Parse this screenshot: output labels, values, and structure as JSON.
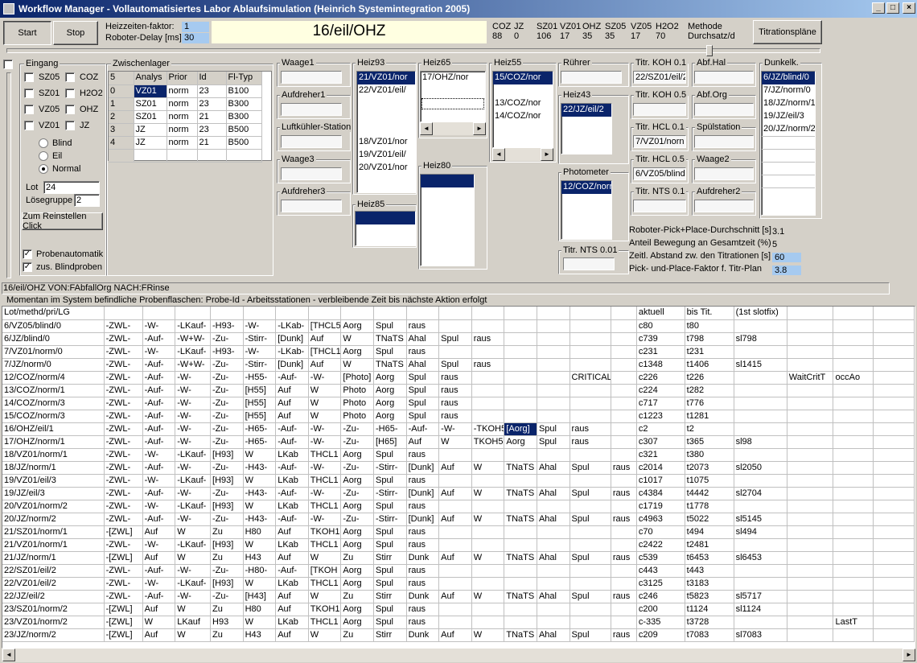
{
  "window": {
    "title": "Workflow Manager - Vollautomatisiertes Labor Ablaufsimulation (Heinrich Systemintegration 2005)",
    "min": "_",
    "max": "□",
    "close": "×"
  },
  "toolbar": {
    "start": "Start",
    "stop": "Stop",
    "heiz_label": "Heizzeiten-faktor:",
    "heiz_value": "1",
    "delay_label": "Roboter-Delay [ms]",
    "delay_value": "30",
    "current": "16/eil/OHZ",
    "titration": "Titrationspläne"
  },
  "counters": [
    {
      "name": "COZ",
      "value": "88"
    },
    {
      "name": "JZ",
      "value": "0"
    },
    {
      "name": "SZ01",
      "value": "106"
    },
    {
      "name": "VZ01",
      "value": "17"
    },
    {
      "name": "OHZ",
      "value": "35"
    },
    {
      "name": "SZ05",
      "value": "35"
    },
    {
      "name": "VZ05",
      "value": "17"
    },
    {
      "name": "H2O2",
      "value": "70"
    }
  ],
  "methode": {
    "label": "Methode",
    "value": "Durchsatz/d"
  },
  "eingang": {
    "title": "Eingang",
    "checks": [
      {
        "label": "SZ05",
        "checked": false
      },
      {
        "label": "COZ",
        "checked": false
      },
      {
        "label": "SZ01",
        "checked": false
      },
      {
        "label": "H2O2",
        "checked": false
      },
      {
        "label": "VZ05",
        "checked": false
      },
      {
        "label": "OHZ",
        "checked": false
      },
      {
        "label": "VZ01",
        "checked": false
      },
      {
        "label": "JZ",
        "checked": false
      }
    ],
    "radios": [
      {
        "label": "Blind",
        "on": false
      },
      {
        "label": "Eil",
        "on": false
      },
      {
        "label": "Normal",
        "on": true
      }
    ],
    "lot_label": "Lot",
    "lot_value": "24",
    "group_label": "Lösegruppe",
    "group_value": "2",
    "reinstellen": "Zum Reinstellen Click",
    "probenautomatik": "Probenautomatik",
    "blindproben": "zus. Blindproben"
  },
  "zwischenlager": {
    "title": "Zwischenlager",
    "headers": [
      "5",
      "Analys",
      "Prior",
      "Id",
      "Fl-Typ"
    ],
    "rows": [
      [
        "0",
        "VZ01",
        "norm",
        "23",
        "B100"
      ],
      [
        "1",
        "SZ01",
        "norm",
        "23",
        "B300"
      ],
      [
        "2",
        "SZ01",
        "norm",
        "21",
        "B300"
      ],
      [
        "3",
        "JZ",
        "norm",
        "23",
        "B500"
      ],
      [
        "4",
        "JZ",
        "norm",
        "21",
        "B500"
      ],
      [
        "",
        "",
        "",
        "",
        ""
      ]
    ]
  },
  "stations": {
    "waage1": "Waage1",
    "aufdreher1": "Aufdreher1",
    "luftkuehler": "Luftkühler-Station",
    "waage3": "Waage3",
    "aufdreher3": "Aufdreher3",
    "heiz93": {
      "title": "Heiz93",
      "items": [
        "21/VZ01/nor",
        "22/VZ01/eil/",
        "",
        "",
        "",
        "18/VZ01/nor",
        "19/VZ01/eil/",
        "20/VZ01/nor"
      ]
    },
    "heiz85": "Heiz85",
    "heiz65": {
      "title": "Heiz65",
      "items": [
        "17/OHZ/nor",
        "",
        ""
      ]
    },
    "heiz80": "Heiz80",
    "heiz55": {
      "title": "Heiz55",
      "items": [
        "15/COZ/nor",
        "",
        "13/COZ/nor",
        "14/COZ/nor"
      ]
    },
    "ruehrer": "Rührer",
    "heiz43": {
      "title": "Heiz43",
      "items": [
        "22/JZ/eil/2"
      ]
    },
    "photometer": {
      "title": "Photometer",
      "items": [
        "12/COZ/norn"
      ]
    },
    "titrnts001": "Titr. NTS 0.01",
    "titrkoh01": {
      "title": "Titr. KOH 0.1",
      "value": "22/SZ01/eil/2"
    },
    "titrkoh05": "Titr. KOH 0.5",
    "titrhcl01": {
      "title": "Titr. HCL 0.1",
      "value": "7/VZ01/norn"
    },
    "titrhcl05": {
      "title": "Titr. HCL 0.5",
      "value": "6/VZ05/blind"
    },
    "titrnts01": "Titr. NTS 0.1",
    "abfhal": "Abf.Hal",
    "abforg": "Abf.Org",
    "spuel": "Spülstation",
    "waage2": "Waage2",
    "aufdreher2": "Aufdreher2",
    "dunkel": {
      "title": "Dunkelk.",
      "items": [
        "6/JZ/blind/0",
        "7/JZ/norm/0",
        "18/JZ/norm/1",
        "19/JZ/eil/3",
        "20/JZ/norm/2"
      ]
    }
  },
  "stats": [
    {
      "label": "Roboter-Pick+Place-Durchschnitt [s]",
      "value": "3.1",
      "boxed": false
    },
    {
      "label": "Anteil Bewegung an Gesamtzeit (%)",
      "value": "5",
      "boxed": false
    },
    {
      "label": "Zeitl. Abstand zw. den Titrationen [s]",
      "value": "60",
      "boxed": true
    },
    {
      "label": "Pick- und-Place-Faktor f. Titr-Plan",
      "value": "3.8",
      "boxed": true
    }
  ],
  "status": "16/eil/OHZ VON:FAbfallOrg NACH:FRinse",
  "legend": "Momentan im System befindliche Probenflaschen:  Probe-Id    -     Arbeitsstationen        -          verbleibende Zeit bis nächste Aktion erfolgt",
  "grid": {
    "headers": [
      "Lot/methd/pri/LG",
      "",
      "",
      "",
      "",
      "",
      "",
      "",
      "",
      "",
      "",
      "",
      "",
      "",
      "",
      "",
      "",
      "aktuell",
      "bis Tit.",
      "(1st slotfix)",
      "",
      "",
      ""
    ],
    "rows": [
      [
        "6/VZ05/blind/0",
        "-ZWL-",
        "-W-",
        "-LKauf-",
        "-H93-",
        "-W-",
        "-LKab-",
        "[THCL5",
        "Aorg",
        "Spul",
        "raus",
        "",
        "",
        "",
        "",
        "",
        "",
        "c80",
        "t80",
        "",
        "",
        "",
        ""
      ],
      [
        "6/JZ/blind/0",
        "-ZWL-",
        "-Auf-",
        "-W+W-",
        "-Zu-",
        "-Stirr-",
        "[Dunk]",
        "Auf",
        "W",
        "TNaTS",
        "Ahal",
        "Spul",
        "raus",
        "",
        "",
        "",
        "",
        "c739",
        "t798",
        "sl798",
        "",
        "",
        ""
      ],
      [
        "7/VZ01/norm/0",
        "-ZWL-",
        "-W-",
        "-LKauf-",
        "-H93-",
        "-W-",
        "-LKab-",
        "[THCL1",
        "Aorg",
        "Spul",
        "raus",
        "",
        "",
        "",
        "",
        "",
        "",
        "c231",
        "t231",
        "",
        "",
        "",
        ""
      ],
      [
        "7/JZ/norm/0",
        "-ZWL-",
        "-Auf-",
        "-W+W-",
        "-Zu-",
        "-Stirr-",
        "[Dunk]",
        "Auf",
        "W",
        "TNaTS",
        "Ahal",
        "Spul",
        "raus",
        "",
        "",
        "",
        "",
        "c1348",
        "t1406",
        "sl1415",
        "",
        "",
        ""
      ],
      [
        "12/COZ/norm/4",
        "-ZWL-",
        "-Auf-",
        "-W-",
        "-Zu-",
        "-H55-",
        "-Auf-",
        "-W-",
        "[Photo]",
        "Aorg",
        "Spul",
        "raus",
        "",
        "",
        "",
        "CRITICAL",
        "",
        "c226",
        "t226",
        "",
        "WaitCritT",
        "occAo",
        ""
      ],
      [
        "13/COZ/norm/1",
        "-ZWL-",
        "-Auf-",
        "-W-",
        "-Zu-",
        "[H55]",
        "Auf",
        "W",
        "Photo",
        "Aorg",
        "Spul",
        "raus",
        "",
        "",
        "",
        "",
        "",
        "c224",
        "t282",
        "",
        "",
        "",
        ""
      ],
      [
        "14/COZ/norm/3",
        "-ZWL-",
        "-Auf-",
        "-W-",
        "-Zu-",
        "[H55]",
        "Auf",
        "W",
        "Photo",
        "Aorg",
        "Spul",
        "raus",
        "",
        "",
        "",
        "",
        "",
        "c717",
        "t776",
        "",
        "",
        "",
        ""
      ],
      [
        "15/COZ/norm/3",
        "-ZWL-",
        "-Auf-",
        "-W-",
        "-Zu-",
        "[H55]",
        "Auf",
        "W",
        "Photo",
        "Aorg",
        "Spul",
        "raus",
        "",
        "",
        "",
        "",
        "",
        "c1223",
        "t1281",
        "",
        "",
        "",
        ""
      ],
      [
        "16/OHZ/eil/1",
        "-ZWL-",
        "-Auf-",
        "-W-",
        "-Zu-",
        "-H65-",
        "-Auf-",
        "-W-",
        "-Zu-",
        "-H65-",
        "-Auf-",
        "-W-",
        "-TKOH5",
        "[Aorg]",
        "Spul",
        "raus",
        "",
        "c2",
        "t2",
        "",
        "",
        "",
        ""
      ],
      [
        "17/OHZ/norm/1",
        "-ZWL-",
        "-Auf-",
        "-W-",
        "-Zu-",
        "-H65-",
        "-Auf-",
        "-W-",
        "-Zu-",
        "[H65]",
        "Auf",
        "W",
        "TKOH5",
        "Aorg",
        "Spul",
        "raus",
        "",
        "c307",
        "t365",
        "sl98",
        "",
        "",
        ""
      ],
      [
        "18/VZ01/norm/1",
        "-ZWL-",
        "-W-",
        "-LKauf-",
        "[H93]",
        "W",
        "LKab",
        "THCL1",
        "Aorg",
        "Spul",
        "raus",
        "",
        "",
        "",
        "",
        "",
        "",
        "c321",
        "t380",
        "",
        "",
        "",
        ""
      ],
      [
        "18/JZ/norm/1",
        "-ZWL-",
        "-Auf-",
        "-W-",
        "-Zu-",
        "-H43-",
        "-Auf-",
        "-W-",
        "-Zu-",
        "-Stirr-",
        "[Dunk]",
        "Auf",
        "W",
        "TNaTS",
        "Ahal",
        "Spul",
        "raus",
        "c2014",
        "t2073",
        "sl2050",
        "",
        "",
        ""
      ],
      [
        "19/VZ01/eil/3",
        "-ZWL-",
        "-W-",
        "-LKauf-",
        "[H93]",
        "W",
        "LKab",
        "THCL1",
        "Aorg",
        "Spul",
        "raus",
        "",
        "",
        "",
        "",
        "",
        "",
        "c1017",
        "t1075",
        "",
        "",
        "",
        ""
      ],
      [
        "19/JZ/eil/3",
        "-ZWL-",
        "-Auf-",
        "-W-",
        "-Zu-",
        "-H43-",
        "-Auf-",
        "-W-",
        "-Zu-",
        "-Stirr-",
        "[Dunk]",
        "Auf",
        "W",
        "TNaTS",
        "Ahal",
        "Spul",
        "raus",
        "c4384",
        "t4442",
        "sl2704",
        "",
        "",
        ""
      ],
      [
        "20/VZ01/norm/2",
        "-ZWL-",
        "-W-",
        "-LKauf-",
        "[H93]",
        "W",
        "LKab",
        "THCL1",
        "Aorg",
        "Spul",
        "raus",
        "",
        "",
        "",
        "",
        "",
        "",
        "c1719",
        "t1778",
        "",
        "",
        "",
        ""
      ],
      [
        "20/JZ/norm/2",
        "-ZWL-",
        "-Auf-",
        "-W-",
        "-Zu-",
        "-H43-",
        "-Auf-",
        "-W-",
        "-Zu-",
        "-Stirr-",
        "[Dunk]",
        "Auf",
        "W",
        "TNaTS",
        "Ahal",
        "Spul",
        "raus",
        "c4963",
        "t5022",
        "sl5145",
        "",
        "",
        ""
      ],
      [
        "21/SZ01/norm/1",
        "-[ZWL]",
        "Auf",
        "W",
        "Zu",
        "H80",
        "Auf",
        "TKOH1",
        "Aorg",
        "Spul",
        "raus",
        "",
        "",
        "",
        "",
        "",
        "",
        "c70",
        "t494",
        "sl494",
        "",
        "",
        ""
      ],
      [
        "21/VZ01/norm/1",
        "-ZWL-",
        "-W-",
        "-LKauf-",
        "[H93]",
        "W",
        "LKab",
        "THCL1",
        "Aorg",
        "Spul",
        "raus",
        "",
        "",
        "",
        "",
        "",
        "",
        "c2422",
        "t2481",
        "",
        "",
        "",
        ""
      ],
      [
        "21/JZ/norm/1",
        "-[ZWL]",
        "Auf",
        "W",
        "Zu",
        "H43",
        "Auf",
        "W",
        "Zu",
        "Stirr",
        "Dunk",
        "Auf",
        "W",
        "TNaTS",
        "Ahal",
        "Spul",
        "raus",
        "c539",
        "t6453",
        "sl6453",
        "",
        "",
        ""
      ],
      [
        "22/SZ01/eil/2",
        "-ZWL-",
        "-Auf-",
        "-W-",
        "-Zu-",
        "-H80-",
        "-Auf-",
        "[TKOH",
        "Aorg",
        "Spul",
        "raus",
        "",
        "",
        "",
        "",
        "",
        "",
        "c443",
        "t443",
        "",
        "",
        "",
        ""
      ],
      [
        "22/VZ01/eil/2",
        "-ZWL-",
        "-W-",
        "-LKauf-",
        "[H93]",
        "W",
        "LKab",
        "THCL1",
        "Aorg",
        "Spul",
        "raus",
        "",
        "",
        "",
        "",
        "",
        "",
        "c3125",
        "t3183",
        "",
        "",
        "",
        ""
      ],
      [
        "22/JZ/eil/2",
        "-ZWL-",
        "-Auf-",
        "-W-",
        "-Zu-",
        "[H43]",
        "Auf",
        "W",
        "Zu",
        "Stirr",
        "Dunk",
        "Auf",
        "W",
        "TNaTS",
        "Ahal",
        "Spul",
        "raus",
        "c246",
        "t5823",
        "sl5717",
        "",
        "",
        ""
      ],
      [
        "23/SZ01/norm/2",
        "-[ZWL]",
        "Auf",
        "W",
        "Zu",
        "H80",
        "Auf",
        "TKOH1",
        "Aorg",
        "Spul",
        "raus",
        "",
        "",
        "",
        "",
        "",
        "",
        "c200",
        "t1124",
        "sl1124",
        "",
        "",
        ""
      ],
      [
        "23/VZ01/norm/2",
        "-[ZWL]",
        "W",
        "LKauf",
        "H93",
        "W",
        "LKab",
        "THCL1",
        "Aorg",
        "Spul",
        "raus",
        "",
        "",
        "",
        "",
        "",
        "",
        "c-335",
        "t3728",
        "",
        "",
        "LastT",
        ""
      ],
      [
        "23/JZ/norm/2",
        "-[ZWL]",
        "Auf",
        "W",
        "Zu",
        "H43",
        "Auf",
        "W",
        "Zu",
        "Stirr",
        "Dunk",
        "Auf",
        "W",
        "TNaTS",
        "Ahal",
        "Spul",
        "raus",
        "c209",
        "t7083",
        "sl7083",
        "",
        "",
        ""
      ]
    ]
  },
  "arrows": {
    "left": "◄",
    "right": "►",
    "up": "▲",
    "down": "▼"
  }
}
